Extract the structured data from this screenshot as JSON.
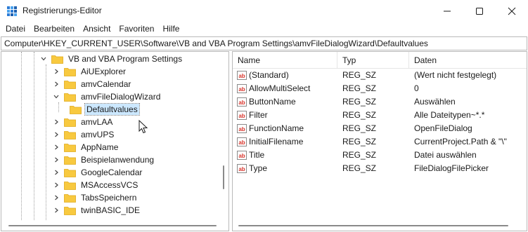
{
  "window": {
    "title": "Registrierungs-Editor",
    "icon": "registry-editor-icon"
  },
  "menu": [
    "Datei",
    "Bearbeiten",
    "Ansicht",
    "Favoriten",
    "Hilfe"
  ],
  "address": "Computer\\HKEY_CURRENT_USER\\Software\\VB and VBA Program Settings\\amvFileDialogWizard\\Defaultvalues",
  "tree": {
    "items": [
      {
        "label": "VB and VBA Program Settings",
        "expanded": true,
        "selected": false
      },
      {
        "label": "AiUExplorer",
        "expanded": false,
        "selected": false
      },
      {
        "label": "amvCalendar",
        "expanded": false,
        "selected": false
      },
      {
        "label": "amvFileDialogWizard",
        "expanded": true,
        "selected": false
      },
      {
        "label": "Defaultvalues",
        "expanded": false,
        "selected": true
      },
      {
        "label": "amvLAA",
        "expanded": false,
        "selected": false
      },
      {
        "label": "amvUPS",
        "expanded": false,
        "selected": false
      },
      {
        "label": "AppName",
        "expanded": false,
        "selected": false
      },
      {
        "label": "Beispielanwendung",
        "expanded": false,
        "selected": false
      },
      {
        "label": "GoogleCalendar",
        "expanded": false,
        "selected": false
      },
      {
        "label": "MSAccessVCS",
        "expanded": false,
        "selected": false
      },
      {
        "label": "TabsSpeichern",
        "expanded": false,
        "selected": false
      },
      {
        "label": "twinBASIC_IDE",
        "expanded": false,
        "selected": false
      }
    ]
  },
  "list": {
    "columns": [
      "Name",
      "Typ",
      "Daten"
    ],
    "rows": [
      {
        "name": "(Standard)",
        "type": "REG_SZ",
        "data": "(Wert nicht festgelegt)"
      },
      {
        "name": "AllowMultiSelect",
        "type": "REG_SZ",
        "data": "0"
      },
      {
        "name": "ButtonName",
        "type": "REG_SZ",
        "data": "Auswählen"
      },
      {
        "name": "Filter",
        "type": "REG_SZ",
        "data": "Alle Dateitypen~*.*"
      },
      {
        "name": "FunctionName",
        "type": "REG_SZ",
        "data": "OpenFileDialog"
      },
      {
        "name": "InitialFilename",
        "type": "REG_SZ",
        "data": "CurrentProject.Path & \"\\\""
      },
      {
        "name": "Title",
        "type": "REG_SZ",
        "data": "Datei auswählen"
      },
      {
        "name": "Type",
        "type": "REG_SZ",
        "data": "FileDialogFilePicker"
      }
    ]
  },
  "colors": {
    "folder": "#f8c93f",
    "selection": "#cce8ff",
    "string_value_icon": "#d9342b"
  }
}
